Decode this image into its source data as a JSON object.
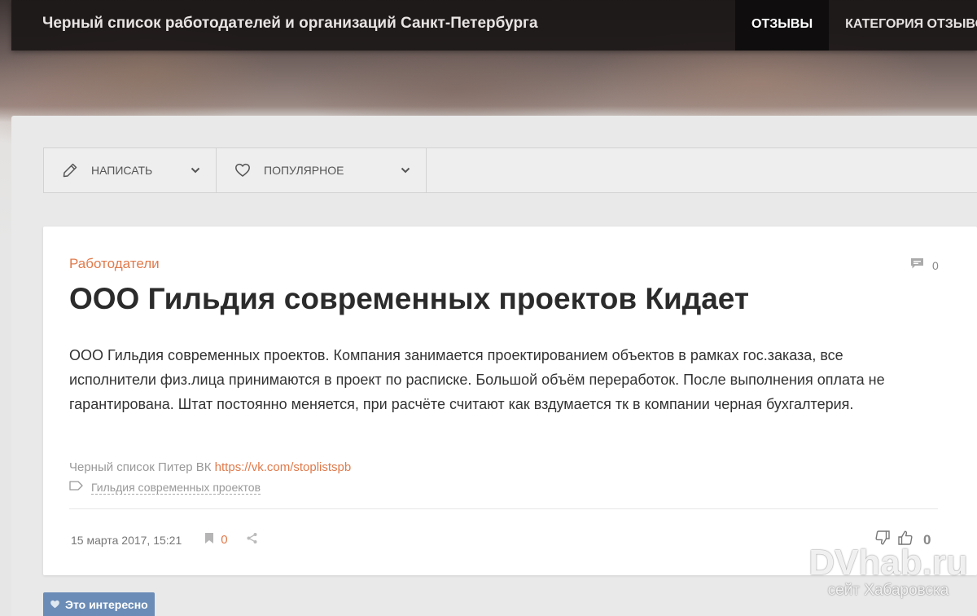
{
  "header": {
    "site_title": "Черный список работодателей и организаций Санкт-Петербурга",
    "nav": [
      {
        "label": "ОТЗЫВЫ",
        "active": true
      },
      {
        "label": "КАТЕГОРИЯ ОТЗЫВОВ",
        "active": false
      }
    ]
  },
  "toolbar": {
    "write_label": "НАПИСАТЬ",
    "popular_label": "ПОПУЛЯРНОЕ",
    "write_icon": "pencil-icon",
    "popular_icon": "heart-icon"
  },
  "post": {
    "category": "Работодатели",
    "comments_count": "0",
    "title": "ООО Гильдия современных проектов Кидает",
    "body": "ООО Гильдия современных проектов. Компания занимается проектированием объектов в рамках гос.заказа, все исполнители физ.лица принимаются в проект по расписке. Большой объём переработок. После выполнения оплата не гарантирована. Штат постоянно меняется, при расчёте считают как вздумается тк в компании черная бухгалтерия.",
    "source_prefix": "Черный список Питер ВК",
    "source_link": "https://vk.com/stoplistspb",
    "tag": "Гильдия современных проектов",
    "date": "15 марта 2017, 15:21",
    "bookmarks_count": "0",
    "rating": "0"
  },
  "interesting": {
    "label": "Это интересно"
  },
  "watermark": {
    "brand": "DVhab.ru",
    "tagline": "сейт Хабаровска"
  },
  "colors": {
    "accent": "#e07a4b",
    "topbar": "#1c1818",
    "interesting_bg": "#6b8cb6"
  }
}
